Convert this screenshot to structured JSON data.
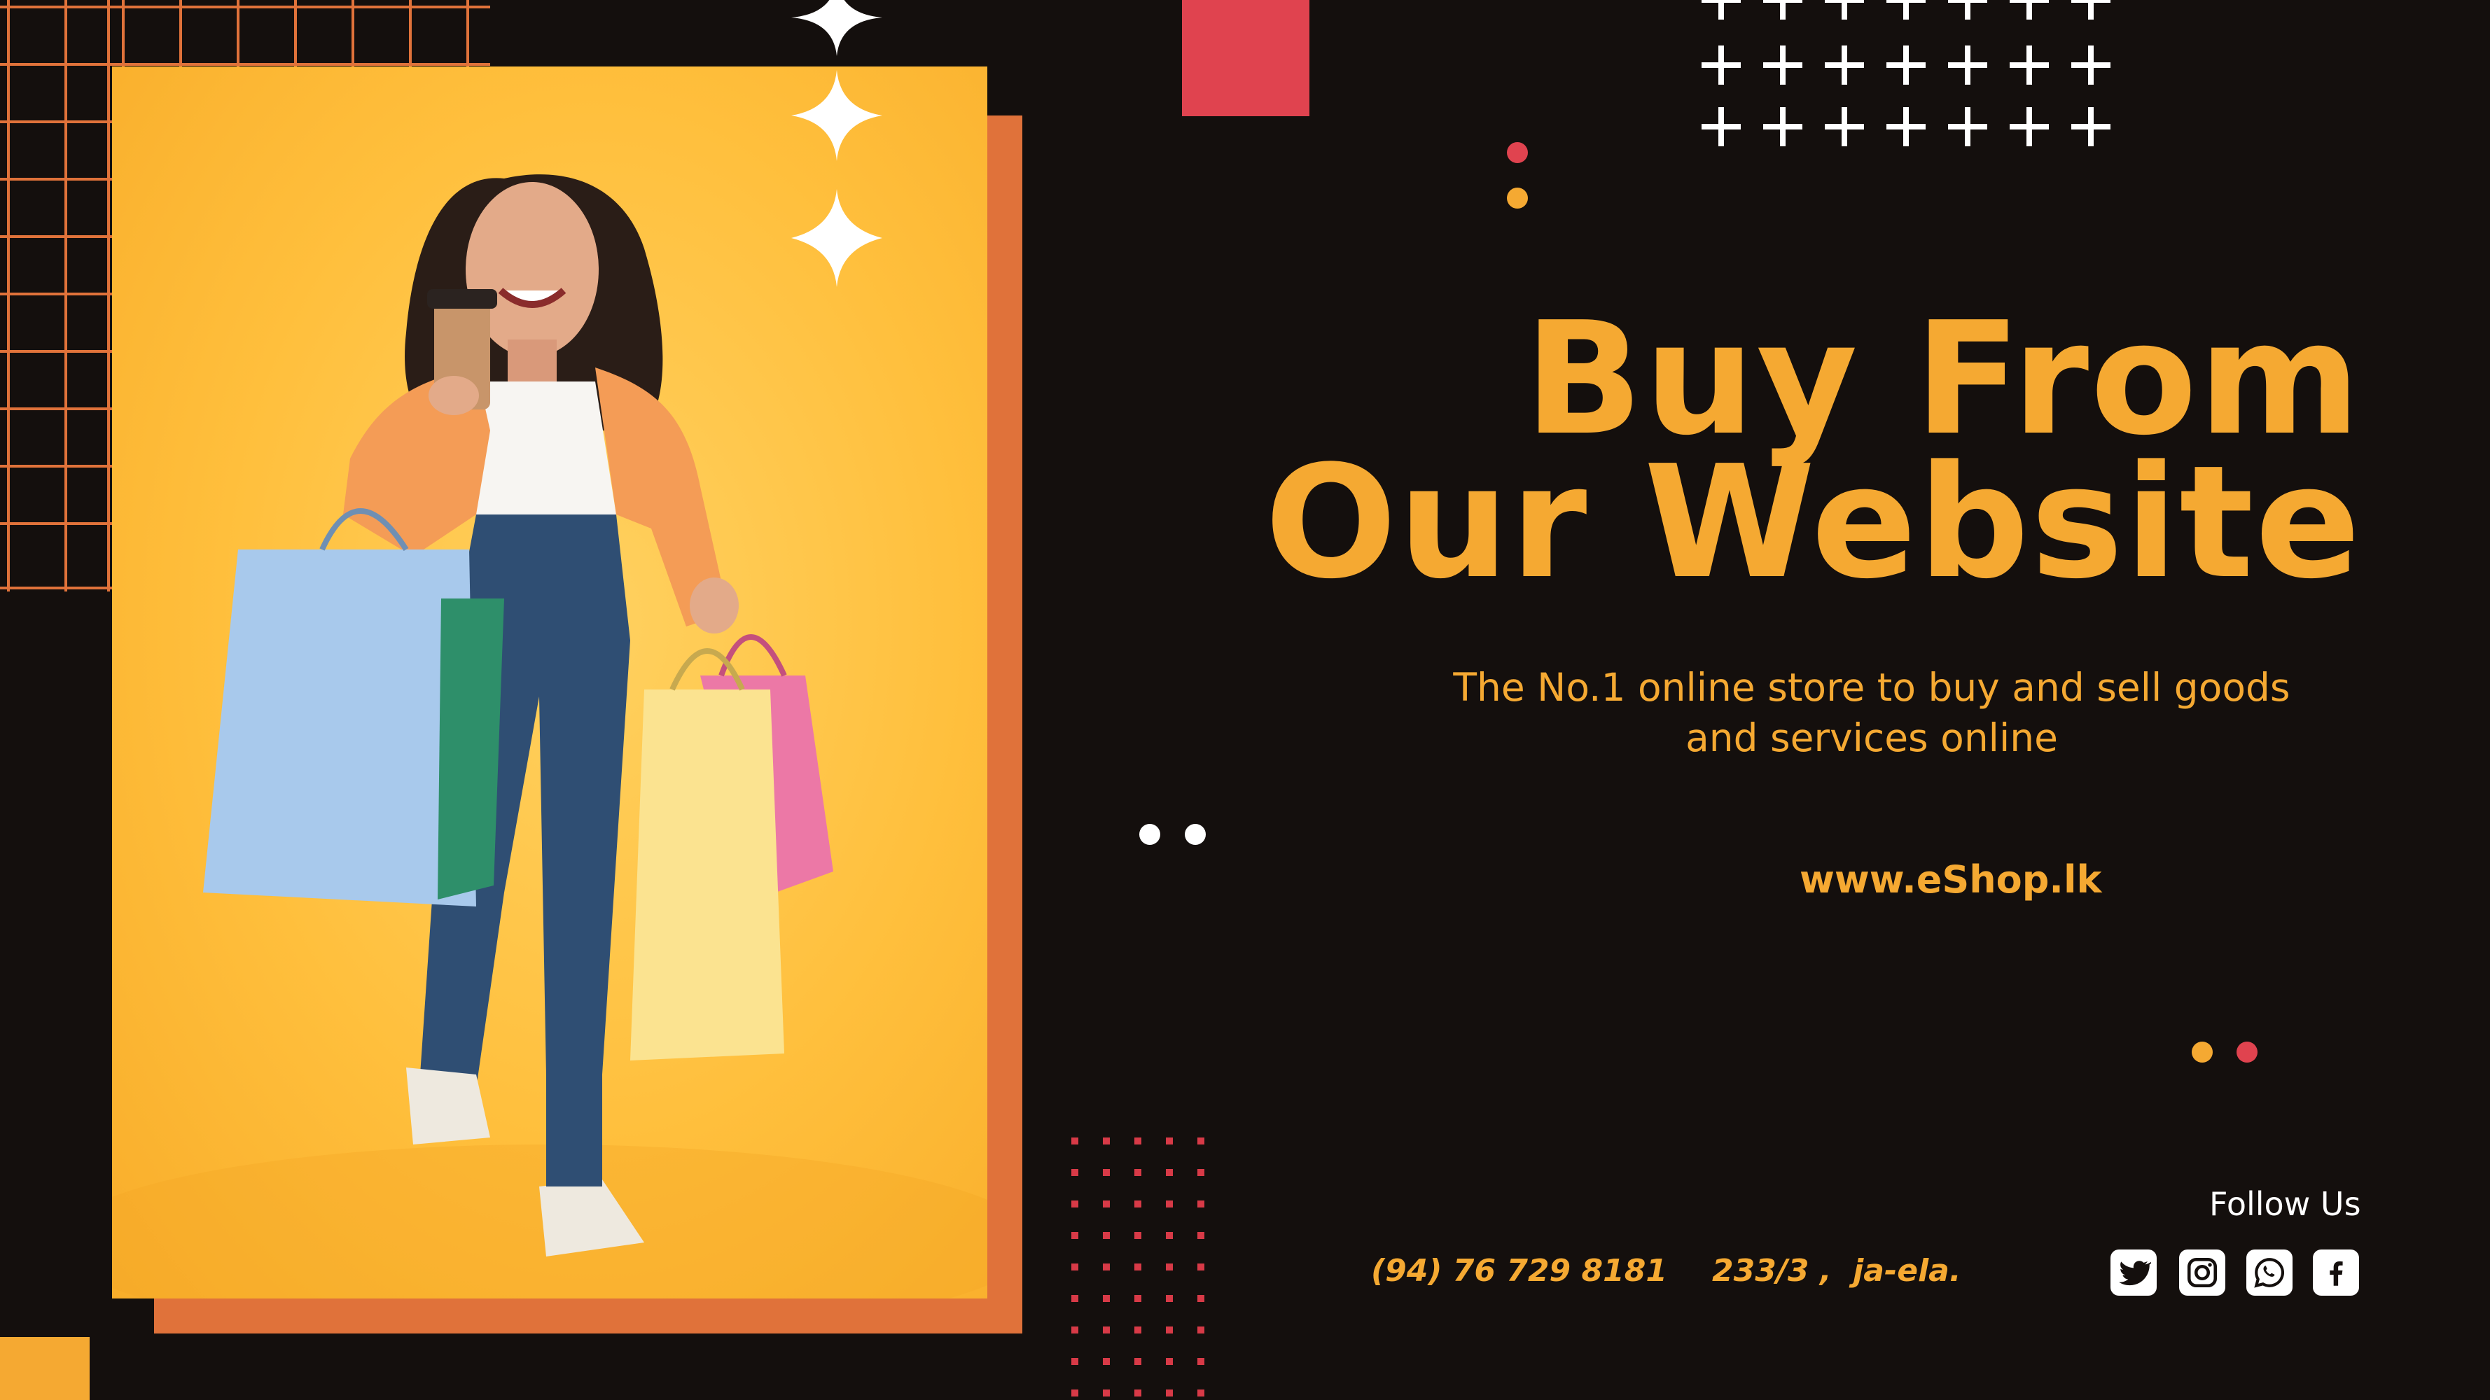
{
  "headline": {
    "line1": "Buy From",
    "line2": "Our Website"
  },
  "subtitle": {
    "line1": "The No.1 online store to buy and sell goods",
    "line2": "and services online"
  },
  "website": "www.eShop.lk",
  "contact": {
    "phone": "(94) 76 729 8181",
    "address": "233/3 ,  ja-ela."
  },
  "social": {
    "label": "Follow Us",
    "icons": [
      "twitter-icon",
      "instagram-icon",
      "whatsapp-icon",
      "facebook-icon"
    ]
  },
  "colors": {
    "background": "#140f0d",
    "accent_orange": "#f5a932",
    "accent_red": "#e0434f",
    "photo_frame": "#e0723a",
    "white": "#ffffff"
  }
}
